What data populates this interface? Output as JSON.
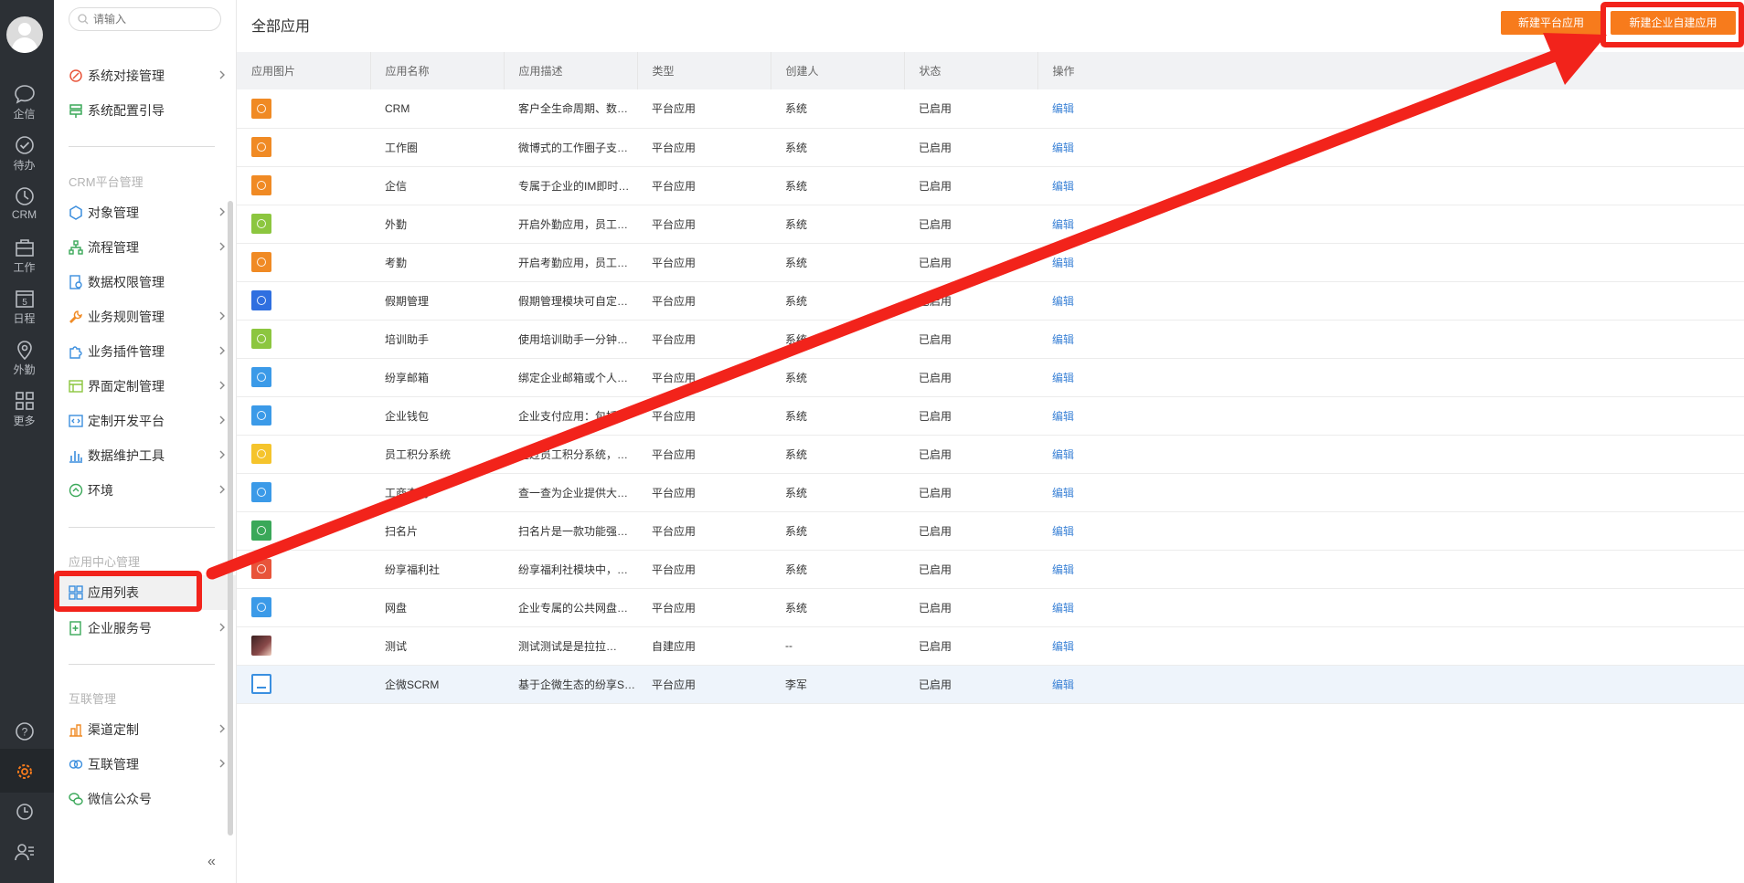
{
  "rail": {
    "items": [
      {
        "label": "企信",
        "icon": "chat-bubble-icon"
      },
      {
        "label": "待办",
        "icon": "check-circle-icon"
      },
      {
        "label": "CRM",
        "icon": "clock-icon"
      },
      {
        "label": "工作",
        "icon": "briefcase-icon"
      },
      {
        "label": "日程",
        "icon": "calendar-icon",
        "day": "5"
      },
      {
        "label": "外勤",
        "icon": "location-pin-icon"
      },
      {
        "label": "更多",
        "icon": "grid-icon"
      }
    ],
    "bottom_icons": [
      "help-icon",
      "settings-icon",
      "history-icon",
      "contacts-icon"
    ]
  },
  "sidebar": {
    "search_placeholder": "请输入",
    "top_items": [
      {
        "label": "系统对接管理",
        "has_arrow": true,
        "icon_color": "#e8543a"
      },
      {
        "label": "系统配置引导",
        "has_arrow": false,
        "icon_color": "#3aa859"
      }
    ],
    "groups": [
      {
        "title": "CRM平台管理",
        "items": [
          {
            "label": "对象管理",
            "has_arrow": true,
            "icon_color": "#3b8ede"
          },
          {
            "label": "流程管理",
            "has_arrow": true,
            "icon_color": "#3aa859"
          },
          {
            "label": "数据权限管理",
            "has_arrow": false,
            "icon_color": "#3b8ede"
          },
          {
            "label": "业务规则管理",
            "has_arrow": true,
            "icon_color": "#f08a24"
          },
          {
            "label": "业务插件管理",
            "has_arrow": true,
            "icon_color": "#3b8ede"
          },
          {
            "label": "界面定制管理",
            "has_arrow": true,
            "icon_color": "#8cc63f"
          },
          {
            "label": "定制开发平台",
            "has_arrow": true,
            "icon_color": "#3b8ede"
          },
          {
            "label": "数据维护工具",
            "has_arrow": true,
            "icon_color": "#3b8ede"
          },
          {
            "label": "环境",
            "has_arrow": true,
            "icon_color": "#3aa859"
          }
        ]
      },
      {
        "title": "应用中心管理",
        "items": [
          {
            "label": "应用列表",
            "has_arrow": false,
            "active": true,
            "icon_color": "#3b8ede"
          },
          {
            "label": "企业服务号",
            "has_arrow": true,
            "icon_color": "#3aa859"
          }
        ]
      },
      {
        "title": "互联管理",
        "items": [
          {
            "label": "渠道定制",
            "has_arrow": true,
            "icon_color": "#f08a24"
          },
          {
            "label": "互联管理",
            "has_arrow": true,
            "icon_color": "#3b8ede"
          },
          {
            "label": "微信公众号",
            "has_arrow": false,
            "icon_color": "#3aa859"
          }
        ]
      }
    ],
    "collapse_glyph": "«"
  },
  "main": {
    "title": "全部应用",
    "buttons": {
      "new_platform_app": "新建平台应用",
      "new_custom_app": "新建企业自建应用"
    },
    "columns": [
      "应用图片",
      "应用名称",
      "应用描述",
      "类型",
      "创建人",
      "状态",
      "操作"
    ],
    "rows": [
      {
        "icon_color": "#f08a24",
        "name": "CRM",
        "desc": "客户全生命周期、数…",
        "type": "平台应用",
        "creator": "系统",
        "status": "已启用",
        "action": "编辑"
      },
      {
        "icon_color": "#f08a24",
        "name": "工作圈",
        "desc": "微博式的工作圈子支…",
        "type": "平台应用",
        "creator": "系统",
        "status": "已启用",
        "action": "编辑"
      },
      {
        "icon_color": "#f08a24",
        "name": "企信",
        "desc": "专属于企业的IM即时…",
        "type": "平台应用",
        "creator": "系统",
        "status": "已启用",
        "action": "编辑"
      },
      {
        "icon_color": "#8cc63f",
        "name": "外勤",
        "desc": "开启外勤应用，员工…",
        "type": "平台应用",
        "creator": "系统",
        "status": "已启用",
        "action": "编辑"
      },
      {
        "icon_color": "#f08a24",
        "name": "考勤",
        "desc": "开启考勤应用，员工…",
        "type": "平台应用",
        "creator": "系统",
        "status": "已启用",
        "action": "编辑"
      },
      {
        "icon_color": "#2f6fe0",
        "name": "假期管理",
        "desc": "假期管理模块可自定…",
        "type": "平台应用",
        "creator": "系统",
        "status": "已启用",
        "action": "编辑"
      },
      {
        "icon_color": "#8cc63f",
        "name": "培训助手",
        "desc": "使用培训助手一分钟…",
        "type": "平台应用",
        "creator": "系统",
        "status": "已启用",
        "action": "编辑"
      },
      {
        "icon_color": "#3b9ae8",
        "name": "纷享邮箱",
        "desc": "绑定企业邮箱或个人…",
        "type": "平台应用",
        "creator": "系统",
        "status": "已启用",
        "action": "编辑"
      },
      {
        "icon_color": "#3b9ae8",
        "name": "企业钱包",
        "desc": "企业支付应用：包括…",
        "type": "平台应用",
        "creator": "系统",
        "status": "已启用",
        "action": "编辑"
      },
      {
        "icon_color": "#f5c42c",
        "name": "员工积分系统",
        "desc": "通过员工积分系统，…",
        "type": "平台应用",
        "creator": "系统",
        "status": "已启用",
        "action": "编辑"
      },
      {
        "icon_color": "#3b9ae8",
        "name": "工商查询",
        "desc": "查一查为企业提供大…",
        "type": "平台应用",
        "creator": "系统",
        "status": "已启用",
        "action": "编辑"
      },
      {
        "icon_color": "#3aa859",
        "name": "扫名片",
        "desc": "扫名片是一款功能强…",
        "type": "平台应用",
        "creator": "系统",
        "status": "已启用",
        "action": "编辑"
      },
      {
        "icon_color": "#e8543a",
        "name": "纷享福利社",
        "desc": "纷享福利社模块中，…",
        "type": "平台应用",
        "creator": "系统",
        "status": "已启用",
        "action": "编辑"
      },
      {
        "icon_color": "#3b9ae8",
        "name": "网盘",
        "desc": "企业专属的公共网盘…",
        "type": "平台应用",
        "creator": "系统",
        "status": "已启用",
        "action": "编辑"
      },
      {
        "icon_color": "photo",
        "name": "测试",
        "desc": "测试测试是是拉拉…",
        "type": "自建应用",
        "creator": "--",
        "status": "已启用",
        "action": "编辑"
      },
      {
        "icon_color": "outline",
        "name": "企微SCRM",
        "desc": "基于企微生态的纷享S…",
        "type": "平台应用",
        "creator": "李军",
        "status": "已启用",
        "action": "编辑",
        "highlighted": true
      }
    ]
  },
  "colors": {
    "accent": "#f77b1c",
    "link": "#3b82d6",
    "annotation_red": "#f2231b",
    "rail_bg": "#2c3035"
  }
}
